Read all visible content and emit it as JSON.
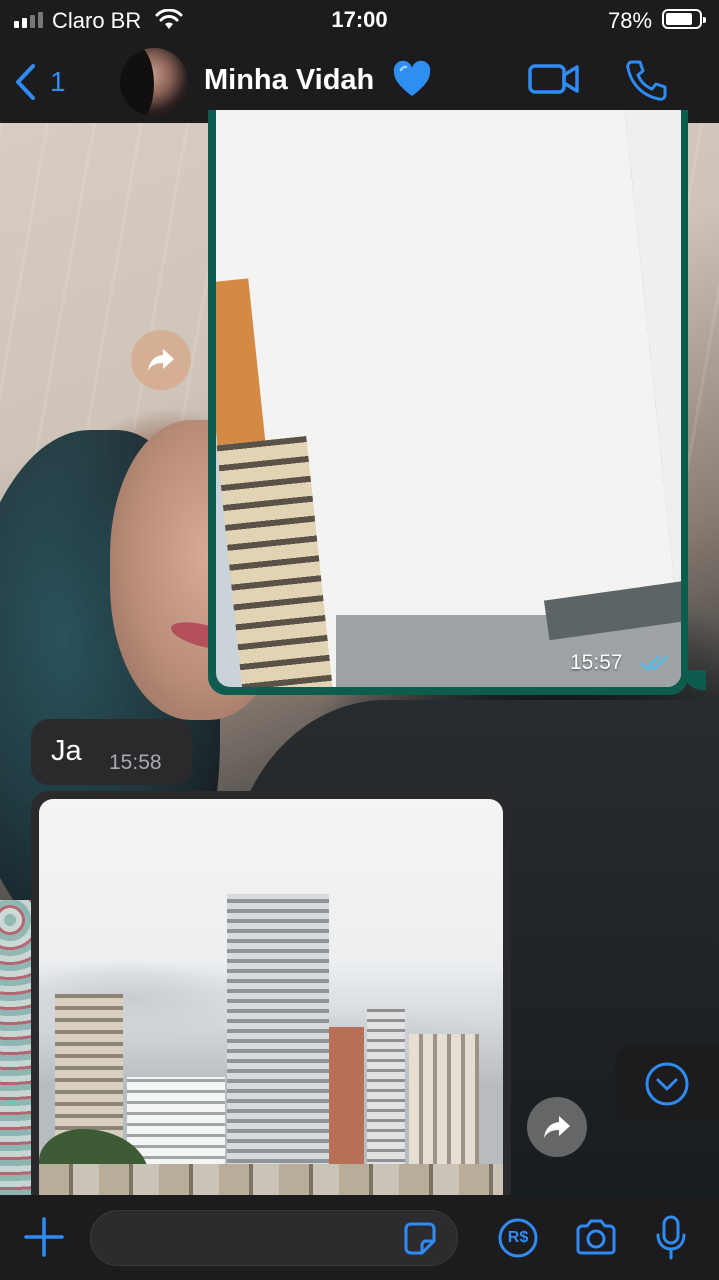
{
  "status_bar": {
    "carrier": "Claro BR",
    "time": "17:00",
    "battery_percent": "78%",
    "battery_level": 0.78,
    "signal_bars": 2
  },
  "header": {
    "back_label": "1",
    "contact_name": "Minha Vidah",
    "contact_emoji_icon": "blue-heart-icon",
    "icons": [
      "back-chevron-icon",
      "video-camera-icon",
      "phone-icon"
    ]
  },
  "messages": [
    {
      "direction": "outgoing",
      "type": "image",
      "image_desc_icon": "photo",
      "time": "15:57",
      "status_icon": "double-check-icon"
    },
    {
      "direction": "incoming",
      "type": "text",
      "text": "Ja",
      "time": "15:58"
    },
    {
      "direction": "incoming",
      "type": "image",
      "image_desc_icon": "photo"
    }
  ],
  "input_bar": {
    "placeholder": "",
    "icons": [
      "plus-icon",
      "sticker-icon",
      "payment-icon",
      "camera-icon",
      "microphone-icon"
    ],
    "pay_symbol": "R$"
  },
  "colors": {
    "bar_bg": "#1c1c1e",
    "accent_blue": "#2f8cf5",
    "outgoing_bubble": "#0d5c4d",
    "incoming_bubble": "#2a2a2c",
    "read_ticks": "#53bdeb"
  }
}
